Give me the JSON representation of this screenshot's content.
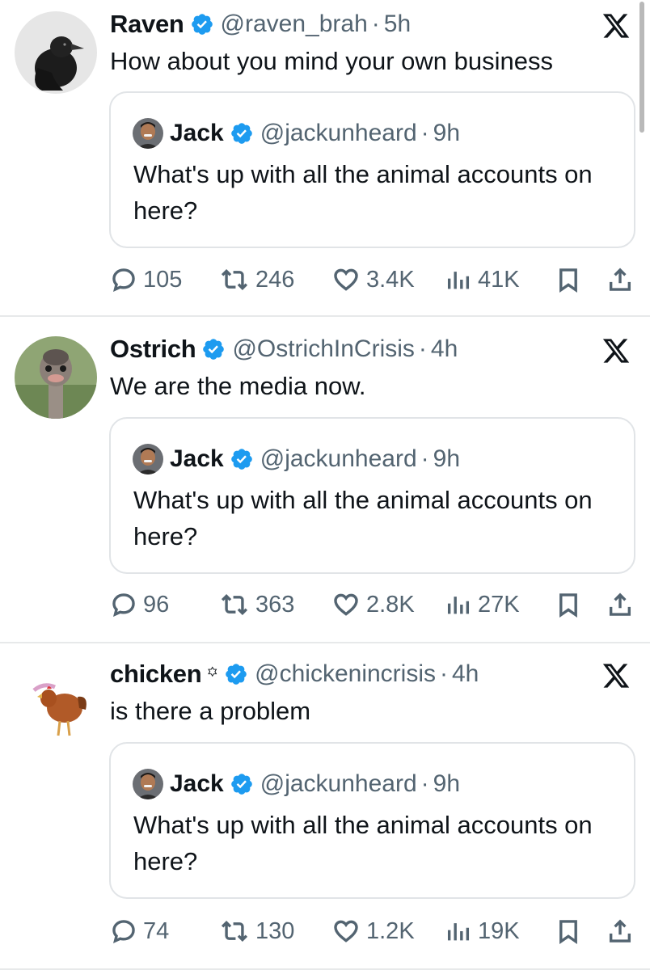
{
  "colors": {
    "text_primary": "#0f1419",
    "text_secondary": "#536471",
    "verified_blue": "#1d9bf0",
    "divider": "#e7e9ea"
  },
  "tweets": [
    {
      "name": "Raven",
      "name_suffix": "",
      "handle": "@raven_brah",
      "separator": "·",
      "time": "5h",
      "text": "How about you mind your own business",
      "avatar": "raven-avatar",
      "quote": {
        "name": "Jack",
        "handle": "@jackunheard",
        "separator": "·",
        "time": "9h",
        "text": "What's up with all the animal accounts on here?"
      },
      "stats": {
        "replies": "105",
        "retweets": "246",
        "likes": "3.4K",
        "views": "41K"
      }
    },
    {
      "name": "Ostrich",
      "name_suffix": "",
      "handle": "@OstrichInCrisis",
      "separator": "·",
      "time": "4h",
      "text": "We are the media now.",
      "avatar": "ostrich-avatar",
      "quote": {
        "name": "Jack",
        "handle": "@jackunheard",
        "separator": "·",
        "time": "9h",
        "text": "What's up with all the animal accounts on here?"
      },
      "stats": {
        "replies": "96",
        "retweets": "363",
        "likes": "2.8K",
        "views": "27K"
      }
    },
    {
      "name": "chicken",
      "name_suffix": "꙳",
      "handle": "@chickenincrisis",
      "separator": "·",
      "time": "4h",
      "text": "is there a problem",
      "avatar": "chicken-avatar",
      "quote": {
        "name": "Jack",
        "handle": "@jackunheard",
        "separator": "·",
        "time": "9h",
        "text": "What's up with all the animal accounts on here?"
      },
      "stats": {
        "replies": "74",
        "retweets": "130",
        "likes": "1.2K",
        "views": "19K"
      }
    }
  ]
}
